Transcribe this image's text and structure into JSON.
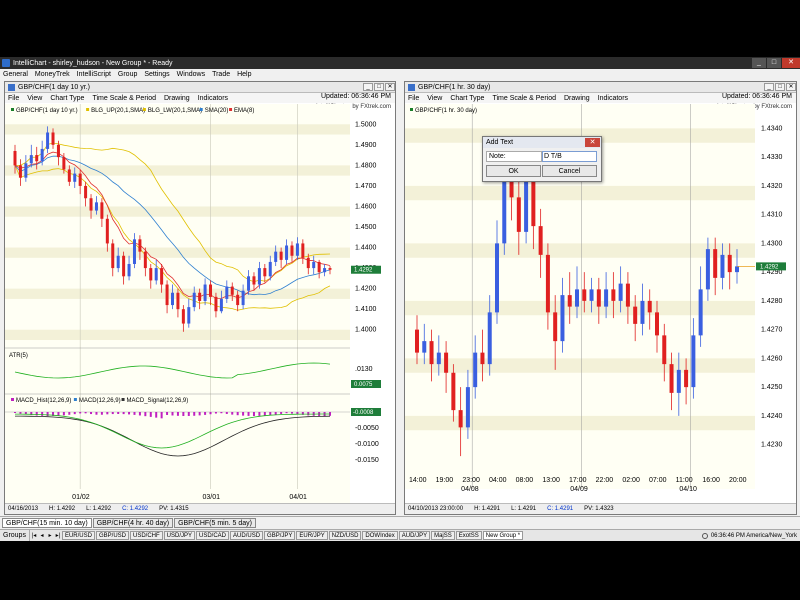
{
  "window": {
    "title": "IntelliChart - shirley_hudson - New Group * - Ready",
    "minimize": "_",
    "maximize": "□",
    "close": "✕"
  },
  "menubar": [
    "General",
    "MoneyTrek",
    "IntelliScript",
    "Group",
    "Settings",
    "Windows",
    "Trade",
    "Help"
  ],
  "pane_menu": [
    "File",
    "View",
    "Chart Type",
    "Time Scale & Period",
    "Drawing",
    "Indicators"
  ],
  "left_chart": {
    "title": "GBP/CHF(1 day  10 yr.)",
    "updated": "Updated: 06:36:46 PM",
    "brand": "IntelliChart™ by FXtrek.com",
    "legend": [
      "GBP/CHF(1 day  10 yr.)",
      "BLG_UP(20,1,SMA)",
      "BLG_LW(20,1,SMA)",
      "SMA(20)",
      "EMA(8)"
    ],
    "price_badge": "1.4292",
    "atr_label": "ATR(5)",
    "atr_badge": "0.0075",
    "macd_labels": [
      "MACD_Hist(12,26,9)",
      "MACD(12,26,9)",
      "MACD_Signal(12,26,9)"
    ],
    "macd_badge": "-0.0008",
    "status": {
      "date": "04/16/2013",
      "high": "H: 1.4292",
      "low": "L: 1.4292",
      "close": "C: 1.4292",
      "pv": "PV: 1.4315"
    }
  },
  "right_chart": {
    "title": "GBP/CHF(1 hr.  30 day)",
    "updated": "Updated: 06:36:46 PM",
    "brand": "IntelliChart™ by FXtrek.com",
    "legend": "GBP/CHF(1 hr.  30 day)",
    "price_badge": "1.4292",
    "status": {
      "date": "04/10/2013 23:00:00",
      "high": "H: 1.4291",
      "low": "L: 1.4291",
      "close": "C: 1.4291",
      "pv": "PV: 1.4323"
    }
  },
  "dialog": {
    "title": "Add Text",
    "close": "✕",
    "note_label": "Note:",
    "note_value": "D T/B",
    "ok": "OK",
    "cancel": "Cancel"
  },
  "chart_tabs": [
    "GBP/CHF(15 min.  10 day)",
    "GBP/CHF(4 hr.  40 day)",
    "GBP/CHF(5 min.  5 day)"
  ],
  "bottom": {
    "groups": "Groups",
    "tabs": [
      "EUR/USD",
      "GBP/USD",
      "USD/CHF",
      "USD/JPY",
      "USD/CAD",
      "AUD/USD",
      "GBP/JPY",
      "EUR/JPY",
      "NZD/USD",
      "DOWIndex",
      "AUD/JPY",
      "MajSS",
      "ExotSS",
      "New Group *"
    ],
    "clock": "06:36:46 PM America/New_York"
  },
  "colors": {
    "bull": "#3a5fe0",
    "bear": "#e02020",
    "bb": "#e0c000",
    "sma": "#2e7fd0",
    "ema": "#e03030",
    "atr": "#20b020",
    "macd_hist": "#c020c0",
    "badge": "#1e7d3a"
  },
  "chart_data": [
    {
      "type": "candlestick",
      "title": "GBP/CHF(1 day  10 yr.)",
      "ylim": [
        1.395,
        1.505
      ],
      "y_ticks": [
        "1.5000",
        "1.4900",
        "1.4800",
        "1.4700",
        "1.4600",
        "1.4500",
        "1.4400",
        "1.4300",
        "1.4200",
        "1.4100",
        "1.4000"
      ],
      "x_ticks": [
        "01/02",
        "03/01",
        "04/01"
      ],
      "atr_ticks": [
        ".0130",
        ".0075"
      ],
      "macd_ticks": [
        "-0.0000",
        "-0.0050",
        "-0.0100",
        "-0.0150"
      ],
      "candles": [
        [
          1.487,
          1.48,
          1.49,
          1.476
        ],
        [
          1.48,
          1.474,
          1.483,
          1.47
        ],
        [
          1.474,
          1.481,
          1.485,
          1.472
        ],
        [
          1.481,
          1.485,
          1.49,
          1.479
        ],
        [
          1.485,
          1.482,
          1.489,
          1.478
        ],
        [
          1.482,
          1.488,
          1.492,
          1.48
        ],
        [
          1.488,
          1.496,
          1.499,
          1.486
        ],
        [
          1.496,
          1.49,
          1.498,
          1.488
        ],
        [
          1.49,
          1.484,
          1.492,
          1.48
        ],
        [
          1.484,
          1.478,
          1.486,
          1.476
        ],
        [
          1.478,
          1.472,
          1.48,
          1.47
        ],
        [
          1.472,
          1.476,
          1.479,
          1.469
        ],
        [
          1.476,
          1.47,
          1.478,
          1.466
        ],
        [
          1.47,
          1.464,
          1.472,
          1.46
        ],
        [
          1.464,
          1.458,
          1.466,
          1.454
        ],
        [
          1.458,
          1.462,
          1.465,
          1.456
        ],
        [
          1.462,
          1.454,
          1.464,
          1.45
        ],
        [
          1.454,
          1.442,
          1.456,
          1.438
        ],
        [
          1.442,
          1.43,
          1.444,
          1.426
        ],
        [
          1.43,
          1.436,
          1.44,
          1.428
        ],
        [
          1.436,
          1.426,
          1.438,
          1.422
        ],
        [
          1.426,
          1.432,
          1.436,
          1.424
        ],
        [
          1.432,
          1.444,
          1.447,
          1.43
        ],
        [
          1.444,
          1.438,
          1.446,
          1.434
        ],
        [
          1.438,
          1.43,
          1.44,
          1.426
        ],
        [
          1.43,
          1.424,
          1.432,
          1.42
        ],
        [
          1.424,
          1.43,
          1.434,
          1.422
        ],
        [
          1.43,
          1.422,
          1.432,
          1.418
        ],
        [
          1.422,
          1.412,
          1.424,
          1.408
        ],
        [
          1.412,
          1.418,
          1.422,
          1.41
        ],
        [
          1.418,
          1.41,
          1.42,
          1.406
        ],
        [
          1.41,
          1.403,
          1.412,
          1.399
        ],
        [
          1.403,
          1.411,
          1.415,
          1.401
        ],
        [
          1.411,
          1.418,
          1.421,
          1.409
        ],
        [
          1.418,
          1.414,
          1.42,
          1.41
        ],
        [
          1.414,
          1.422,
          1.425,
          1.412
        ],
        [
          1.422,
          1.416,
          1.424,
          1.412
        ],
        [
          1.416,
          1.409,
          1.418,
          1.406
        ],
        [
          1.409,
          1.415,
          1.419,
          1.408
        ],
        [
          1.415,
          1.421,
          1.424,
          1.413
        ],
        [
          1.421,
          1.417,
          1.423,
          1.414
        ],
        [
          1.417,
          1.412,
          1.419,
          1.409
        ],
        [
          1.412,
          1.419,
          1.422,
          1.41
        ],
        [
          1.419,
          1.426,
          1.429,
          1.417
        ],
        [
          1.426,
          1.422,
          1.428,
          1.419
        ],
        [
          1.422,
          1.43,
          1.433,
          1.42
        ],
        [
          1.43,
          1.426,
          1.432,
          1.423
        ],
        [
          1.426,
          1.433,
          1.436,
          1.424
        ],
        [
          1.433,
          1.438,
          1.441,
          1.431
        ],
        [
          1.438,
          1.434,
          1.44,
          1.43
        ],
        [
          1.434,
          1.441,
          1.444,
          1.432
        ],
        [
          1.441,
          1.436,
          1.443,
          1.433
        ],
        [
          1.436,
          1.442,
          1.445,
          1.434
        ],
        [
          1.442,
          1.435,
          1.444,
          1.432
        ],
        [
          1.435,
          1.43,
          1.437,
          1.427
        ],
        [
          1.43,
          1.433,
          1.436,
          1.427
        ],
        [
          1.433,
          1.428,
          1.434,
          1.425
        ],
        [
          1.428,
          1.43,
          1.432,
          1.426
        ],
        [
          1.43,
          1.4292,
          1.431,
          1.427
        ]
      ]
    },
    {
      "type": "candlestick",
      "title": "GBP/CHF(1 hr.  30 day)",
      "ylim": [
        1.4225,
        1.4345
      ],
      "y_ticks": [
        "1.4340",
        "1.4330",
        "1.4320",
        "1.4310",
        "1.4300",
        "1.4290",
        "1.4280",
        "1.4270",
        "1.4260",
        "1.4250",
        "1.4240",
        "1.4230"
      ],
      "x_ticks": [
        "14:00",
        "19:00",
        "23:00",
        "04:00",
        "08:00",
        "13:00",
        "17:00",
        "22:00",
        "02:00",
        "07:00",
        "11:00",
        "16:00",
        "20:00"
      ],
      "date_ticks": [
        "04/08",
        "04/09",
        "04/10"
      ],
      "candles": [
        [
          1.427,
          1.4262,
          1.4275,
          1.4258
        ],
        [
          1.4262,
          1.4266,
          1.4272,
          1.4258
        ],
        [
          1.4266,
          1.4258,
          1.427,
          1.4252
        ],
        [
          1.4258,
          1.4262,
          1.4268,
          1.4254
        ],
        [
          1.4262,
          1.4255,
          1.4266,
          1.4248
        ],
        [
          1.4255,
          1.4242,
          1.4258,
          1.4238
        ],
        [
          1.4242,
          1.4236,
          1.425,
          1.4226
        ],
        [
          1.4236,
          1.425,
          1.4256,
          1.4232
        ],
        [
          1.425,
          1.4262,
          1.4268,
          1.4246
        ],
        [
          1.4262,
          1.4258,
          1.427,
          1.4252
        ],
        [
          1.4258,
          1.4276,
          1.4282,
          1.4254
        ],
        [
          1.4276,
          1.43,
          1.4308,
          1.4272
        ],
        [
          1.43,
          1.4328,
          1.4336,
          1.4296
        ],
        [
          1.4328,
          1.4316,
          1.4334,
          1.4308
        ],
        [
          1.4316,
          1.4304,
          1.4322,
          1.4296
        ],
        [
          1.4304,
          1.4322,
          1.4328,
          1.43
        ],
        [
          1.4322,
          1.4306,
          1.4326,
          1.4298
        ],
        [
          1.4306,
          1.4296,
          1.4312,
          1.4288
        ],
        [
          1.4296,
          1.4276,
          1.43,
          1.427
        ],
        [
          1.4276,
          1.4266,
          1.4282,
          1.4256
        ],
        [
          1.4266,
          1.4282,
          1.4288,
          1.4262
        ],
        [
          1.4282,
          1.4278,
          1.429,
          1.4272
        ],
        [
          1.4278,
          1.4284,
          1.4292,
          1.4274
        ],
        [
          1.4284,
          1.428,
          1.429,
          1.4276
        ],
        [
          1.428,
          1.4284,
          1.4288,
          1.4276
        ],
        [
          1.4284,
          1.4278,
          1.4288,
          1.4272
        ],
        [
          1.4278,
          1.4284,
          1.429,
          1.4274
        ],
        [
          1.4284,
          1.428,
          1.429,
          1.4274
        ],
        [
          1.428,
          1.4286,
          1.4292,
          1.4276
        ],
        [
          1.4286,
          1.4278,
          1.429,
          1.4272
        ],
        [
          1.4278,
          1.4272,
          1.4282,
          1.4266
        ],
        [
          1.4272,
          1.428,
          1.4286,
          1.4268
        ],
        [
          1.428,
          1.4276,
          1.4284,
          1.427
        ],
        [
          1.4276,
          1.4268,
          1.428,
          1.4262
        ],
        [
          1.4268,
          1.4258,
          1.4272,
          1.4252
        ],
        [
          1.4258,
          1.4248,
          1.4262,
          1.4242
        ],
        [
          1.4248,
          1.4256,
          1.4262,
          1.424
        ],
        [
          1.4256,
          1.425,
          1.426,
          1.4244
        ],
        [
          1.425,
          1.4268,
          1.4274,
          1.4246
        ],
        [
          1.4268,
          1.4284,
          1.4292,
          1.4264
        ],
        [
          1.4284,
          1.4298,
          1.4302,
          1.428
        ],
        [
          1.4298,
          1.4288,
          1.4302,
          1.4282
        ],
        [
          1.4288,
          1.4296,
          1.43,
          1.4284
        ],
        [
          1.4296,
          1.429,
          1.43,
          1.4284
        ],
        [
          1.429,
          1.4292,
          1.4298,
          1.4286
        ]
      ]
    }
  ]
}
